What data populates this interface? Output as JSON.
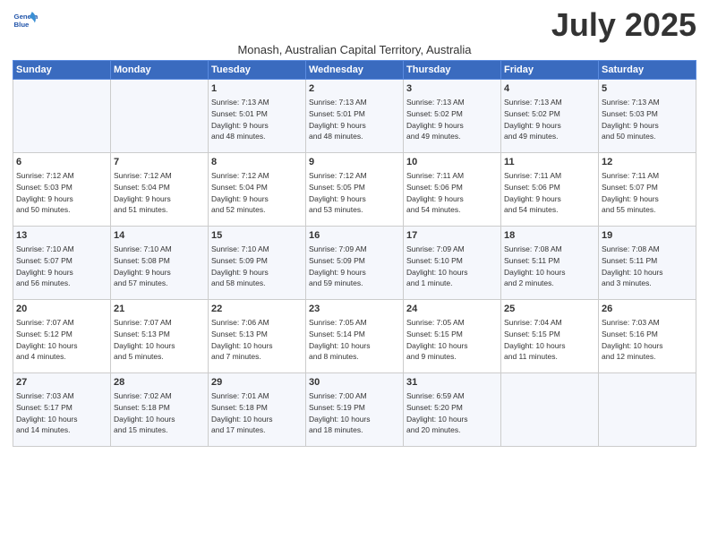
{
  "header": {
    "logo_line1": "General",
    "logo_line2": "Blue",
    "month": "July 2025",
    "subtitle": "Monash, Australian Capital Territory, Australia"
  },
  "days_of_week": [
    "Sunday",
    "Monday",
    "Tuesday",
    "Wednesday",
    "Thursday",
    "Friday",
    "Saturday"
  ],
  "weeks": [
    [
      {
        "day": "",
        "info": ""
      },
      {
        "day": "",
        "info": ""
      },
      {
        "day": "1",
        "info": "Sunrise: 7:13 AM\nSunset: 5:01 PM\nDaylight: 9 hours\nand 48 minutes."
      },
      {
        "day": "2",
        "info": "Sunrise: 7:13 AM\nSunset: 5:01 PM\nDaylight: 9 hours\nand 48 minutes."
      },
      {
        "day": "3",
        "info": "Sunrise: 7:13 AM\nSunset: 5:02 PM\nDaylight: 9 hours\nand 49 minutes."
      },
      {
        "day": "4",
        "info": "Sunrise: 7:13 AM\nSunset: 5:02 PM\nDaylight: 9 hours\nand 49 minutes."
      },
      {
        "day": "5",
        "info": "Sunrise: 7:13 AM\nSunset: 5:03 PM\nDaylight: 9 hours\nand 50 minutes."
      }
    ],
    [
      {
        "day": "6",
        "info": "Sunrise: 7:12 AM\nSunset: 5:03 PM\nDaylight: 9 hours\nand 50 minutes."
      },
      {
        "day": "7",
        "info": "Sunrise: 7:12 AM\nSunset: 5:04 PM\nDaylight: 9 hours\nand 51 minutes."
      },
      {
        "day": "8",
        "info": "Sunrise: 7:12 AM\nSunset: 5:04 PM\nDaylight: 9 hours\nand 52 minutes."
      },
      {
        "day": "9",
        "info": "Sunrise: 7:12 AM\nSunset: 5:05 PM\nDaylight: 9 hours\nand 53 minutes."
      },
      {
        "day": "10",
        "info": "Sunrise: 7:11 AM\nSunset: 5:06 PM\nDaylight: 9 hours\nand 54 minutes."
      },
      {
        "day": "11",
        "info": "Sunrise: 7:11 AM\nSunset: 5:06 PM\nDaylight: 9 hours\nand 54 minutes."
      },
      {
        "day": "12",
        "info": "Sunrise: 7:11 AM\nSunset: 5:07 PM\nDaylight: 9 hours\nand 55 minutes."
      }
    ],
    [
      {
        "day": "13",
        "info": "Sunrise: 7:10 AM\nSunset: 5:07 PM\nDaylight: 9 hours\nand 56 minutes."
      },
      {
        "day": "14",
        "info": "Sunrise: 7:10 AM\nSunset: 5:08 PM\nDaylight: 9 hours\nand 57 minutes."
      },
      {
        "day": "15",
        "info": "Sunrise: 7:10 AM\nSunset: 5:09 PM\nDaylight: 9 hours\nand 58 minutes."
      },
      {
        "day": "16",
        "info": "Sunrise: 7:09 AM\nSunset: 5:09 PM\nDaylight: 9 hours\nand 59 minutes."
      },
      {
        "day": "17",
        "info": "Sunrise: 7:09 AM\nSunset: 5:10 PM\nDaylight: 10 hours\nand 1 minute."
      },
      {
        "day": "18",
        "info": "Sunrise: 7:08 AM\nSunset: 5:11 PM\nDaylight: 10 hours\nand 2 minutes."
      },
      {
        "day": "19",
        "info": "Sunrise: 7:08 AM\nSunset: 5:11 PM\nDaylight: 10 hours\nand 3 minutes."
      }
    ],
    [
      {
        "day": "20",
        "info": "Sunrise: 7:07 AM\nSunset: 5:12 PM\nDaylight: 10 hours\nand 4 minutes."
      },
      {
        "day": "21",
        "info": "Sunrise: 7:07 AM\nSunset: 5:13 PM\nDaylight: 10 hours\nand 5 minutes."
      },
      {
        "day": "22",
        "info": "Sunrise: 7:06 AM\nSunset: 5:13 PM\nDaylight: 10 hours\nand 7 minutes."
      },
      {
        "day": "23",
        "info": "Sunrise: 7:05 AM\nSunset: 5:14 PM\nDaylight: 10 hours\nand 8 minutes."
      },
      {
        "day": "24",
        "info": "Sunrise: 7:05 AM\nSunset: 5:15 PM\nDaylight: 10 hours\nand 9 minutes."
      },
      {
        "day": "25",
        "info": "Sunrise: 7:04 AM\nSunset: 5:15 PM\nDaylight: 10 hours\nand 11 minutes."
      },
      {
        "day": "26",
        "info": "Sunrise: 7:03 AM\nSunset: 5:16 PM\nDaylight: 10 hours\nand 12 minutes."
      }
    ],
    [
      {
        "day": "27",
        "info": "Sunrise: 7:03 AM\nSunset: 5:17 PM\nDaylight: 10 hours\nand 14 minutes."
      },
      {
        "day": "28",
        "info": "Sunrise: 7:02 AM\nSunset: 5:18 PM\nDaylight: 10 hours\nand 15 minutes."
      },
      {
        "day": "29",
        "info": "Sunrise: 7:01 AM\nSunset: 5:18 PM\nDaylight: 10 hours\nand 17 minutes."
      },
      {
        "day": "30",
        "info": "Sunrise: 7:00 AM\nSunset: 5:19 PM\nDaylight: 10 hours\nand 18 minutes."
      },
      {
        "day": "31",
        "info": "Sunrise: 6:59 AM\nSunset: 5:20 PM\nDaylight: 10 hours\nand 20 minutes."
      },
      {
        "day": "",
        "info": ""
      },
      {
        "day": "",
        "info": ""
      }
    ]
  ]
}
